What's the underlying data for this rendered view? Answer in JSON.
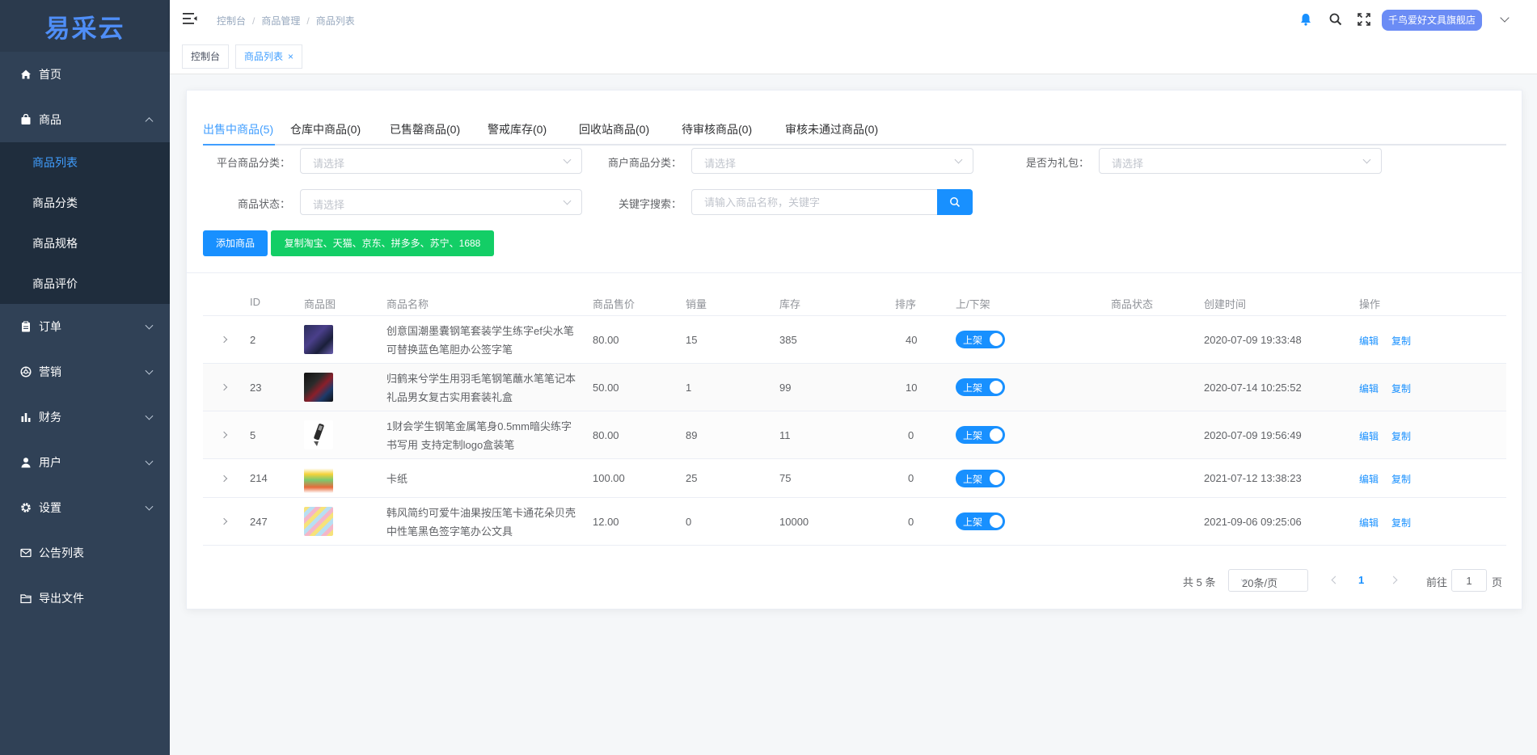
{
  "sidebar": {
    "logo": "易采云",
    "menu": [
      {
        "label": "首页",
        "icon": "home-icon"
      },
      {
        "label": "商品",
        "icon": "bag-icon"
      },
      {
        "label": "订单",
        "icon": "clipboard-icon"
      },
      {
        "label": "营销",
        "icon": "aperture-icon"
      },
      {
        "label": "财务",
        "icon": "bar-chart-icon"
      },
      {
        "label": "用户",
        "icon": "user-icon"
      },
      {
        "label": "设置",
        "icon": "gear-icon"
      },
      {
        "label": "公告列表",
        "icon": "mail-icon"
      },
      {
        "label": "导出文件",
        "icon": "folder-icon"
      }
    ],
    "submenu": [
      "商品列表",
      "商品分类",
      "商品规格",
      "商品评价"
    ]
  },
  "header": {
    "breadcrumb": [
      "控制台",
      "商品管理",
      "商品列表"
    ],
    "shop_name": "千鸟爱好文具旗舰店"
  },
  "tags": [
    "控制台",
    "商品列表"
  ],
  "tabs": [
    "出售中商品(5)",
    "仓库中商品(0)",
    "已售罄商品(0)",
    "警戒库存(0)",
    "回收站商品(0)",
    "待审核商品(0)",
    "审核未通过商品(0)"
  ],
  "filters": {
    "platform_category_label": "平台商品分类：",
    "merchant_category_label": "商户商品分类：",
    "is_gift_label": "是否为礼包：",
    "status_label": "商品状态：",
    "keyword_label": "关键字搜索：",
    "select_placeholder": "请选择",
    "keyword_placeholder": "请输入商品名称，关键字"
  },
  "buttons": {
    "add_product": "添加商品",
    "copy_from": "复制淘宝、天猫、京东、拼多多、苏宁、1688"
  },
  "table": {
    "headers": [
      "ID",
      "商品图",
      "商品名称",
      "商品售价",
      "销量",
      "库存",
      "排序",
      "上/下架",
      "商品状态",
      "创建时间",
      "操作"
    ],
    "rows": [
      {
        "id": "2",
        "name": "创意国潮墨囊钢笔套装学生练字ef尖水笔可替换蓝色笔胆办公签字笔",
        "price": "80.00",
        "sales": "15",
        "stock": "385",
        "sort": "40",
        "shelf": "上架",
        "status": "",
        "created": "2020-07-09 19:33:48",
        "edit": "编辑",
        "copy": "复制"
      },
      {
        "id": "23",
        "name": "归鹤来兮学生用羽毛笔钢笔蘸水笔笔记本礼品男女复古实用套装礼盒",
        "price": "50.00",
        "sales": "1",
        "stock": "99",
        "sort": "10",
        "shelf": "上架",
        "status": "",
        "created": "2020-07-14 10:25:52",
        "edit": "编辑",
        "copy": "复制"
      },
      {
        "id": "5",
        "name": "1财会学生钢笔金属笔身0.5mm暗尖练字书写用 支持定制logo盒装笔",
        "price": "80.00",
        "sales": "89",
        "stock": "11",
        "sort": "0",
        "shelf": "上架",
        "status": "",
        "created": "2020-07-09 19:56:49",
        "edit": "编辑",
        "copy": "复制"
      },
      {
        "id": "214",
        "name": "卡纸",
        "price": "100.00",
        "sales": "25",
        "stock": "75",
        "sort": "0",
        "shelf": "上架",
        "status": "",
        "created": "2021-07-12 13:38:23",
        "edit": "编辑",
        "copy": "复制"
      },
      {
        "id": "247",
        "name": "韩风简约可爱牛油果按压笔卡通花朵贝壳中性笔黑色签字笔办公文具",
        "price": "12.00",
        "sales": "0",
        "stock": "10000",
        "sort": "0",
        "shelf": "上架",
        "status": "",
        "created": "2021-09-06 09:25:06",
        "edit": "编辑",
        "copy": "复制"
      }
    ]
  },
  "pagination": {
    "total": "共 5 条",
    "page_size": "20条/页",
    "current": "1",
    "goto": "前往",
    "goto_value": "1",
    "page_unit": "页"
  },
  "colors": {
    "primary": "#1890ff",
    "success": "#13ce66",
    "sidebar": "#304156",
    "logo": "#4f8ef7"
  }
}
